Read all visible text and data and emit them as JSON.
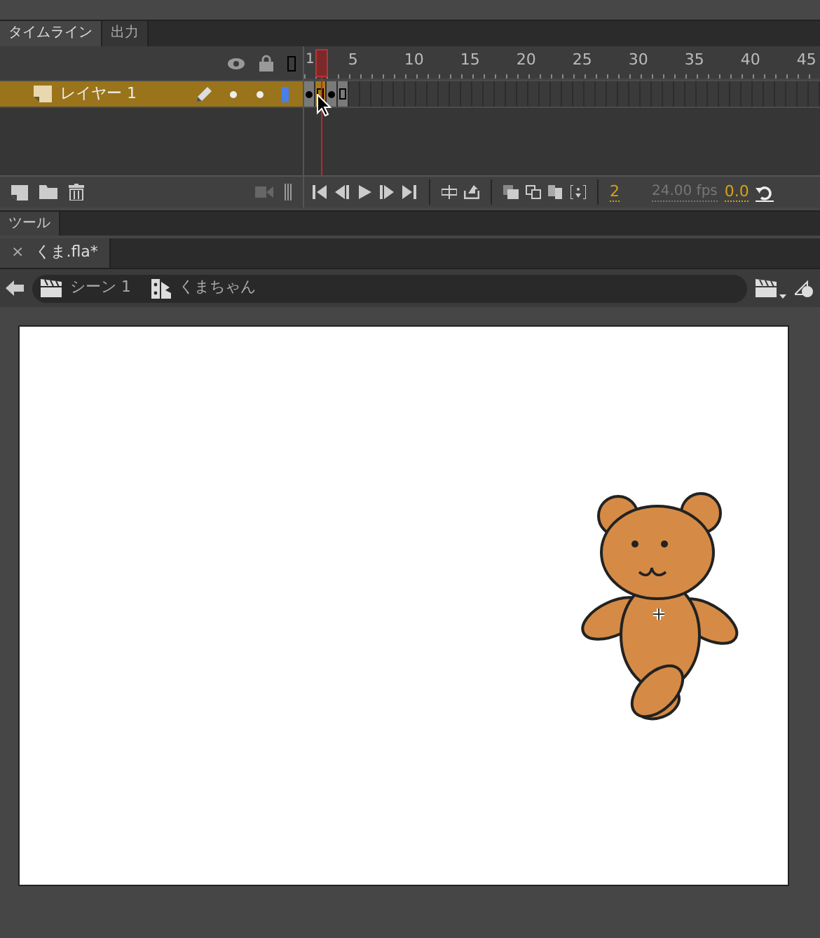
{
  "panel_tabs": [
    {
      "label": "タイムライン",
      "selected": true
    },
    {
      "label": "出力",
      "selected": false
    }
  ],
  "timeline": {
    "ruler": [
      "1",
      "5",
      "10",
      "15",
      "20",
      "25",
      "30",
      "35",
      "40",
      "45"
    ],
    "layers": [
      {
        "name": "レイヤー 1",
        "selected": true,
        "visible": true,
        "locked": false,
        "color": "#4a7fe8"
      }
    ],
    "frames": [
      {
        "kind": "keyframe",
        "selected": false
      },
      {
        "kind": "endframe",
        "selected": true
      },
      {
        "kind": "keyframe",
        "selected": false
      },
      {
        "kind": "endframe",
        "selected": false
      }
    ],
    "current_frame": "2",
    "frame_rate": "24.00 fps",
    "elapsed_time": "0.0"
  },
  "tools_tab": {
    "label": "ツール"
  },
  "document_tab": {
    "close": "×",
    "label": "くま.fla*"
  },
  "breadcrumb": [
    {
      "kind": "scene",
      "label": "シーン 1"
    },
    {
      "kind": "symbol",
      "label": "くまちゃん"
    }
  ],
  "stage": {
    "kind": "bear"
  }
}
